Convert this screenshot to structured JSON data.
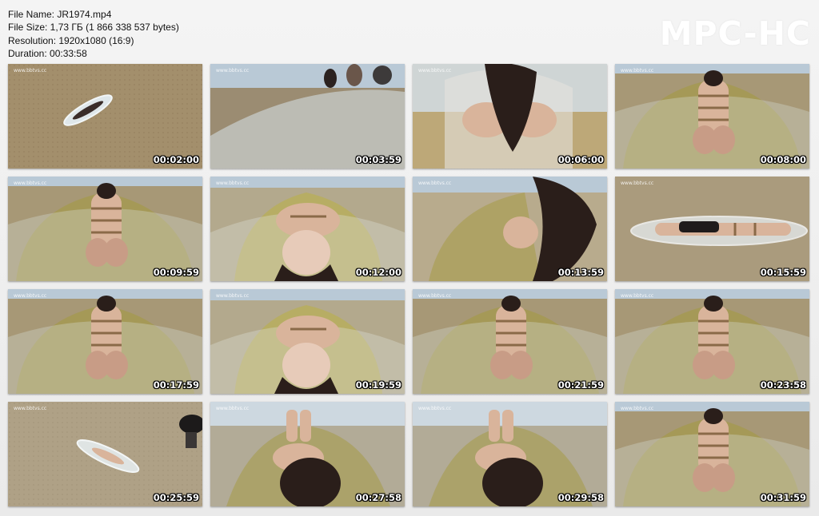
{
  "file_info": {
    "name": "File Name: JR1974.mp4",
    "size": "File Size: 1,73 ГБ (1 866 338 537 bytes)",
    "resolution": "Resolution: 1920x1080 (16:9)",
    "duration": "Duration: 00:33:58"
  },
  "logo": "MPC-HC",
  "watermark": "www.bbtvs.cc",
  "thumbnails": [
    {
      "time": "00:02:00",
      "scene": "aerial"
    },
    {
      "time": "00:03:59",
      "scene": "kayak-people"
    },
    {
      "time": "00:06:00",
      "scene": "hair-closeup"
    },
    {
      "time": "00:08:00",
      "scene": "feet-in-kayak"
    },
    {
      "time": "00:09:59",
      "scene": "feet-in-kayak"
    },
    {
      "time": "00:12:00",
      "scene": "face-in-kayak"
    },
    {
      "time": "00:13:59",
      "scene": "hair-side"
    },
    {
      "time": "00:15:59",
      "scene": "kayak-side"
    },
    {
      "time": "00:17:59",
      "scene": "feet-in-kayak"
    },
    {
      "time": "00:19:59",
      "scene": "face-in-kayak"
    },
    {
      "time": "00:21:59",
      "scene": "feet-in-kayak"
    },
    {
      "time": "00:23:58",
      "scene": "feet-in-kayak"
    },
    {
      "time": "00:25:59",
      "scene": "beach-wide"
    },
    {
      "time": "00:27:58",
      "scene": "head-in-kayak"
    },
    {
      "time": "00:29:58",
      "scene": "head-in-kayak"
    },
    {
      "time": "00:31:59",
      "scene": "feet-in-kayak"
    }
  ]
}
